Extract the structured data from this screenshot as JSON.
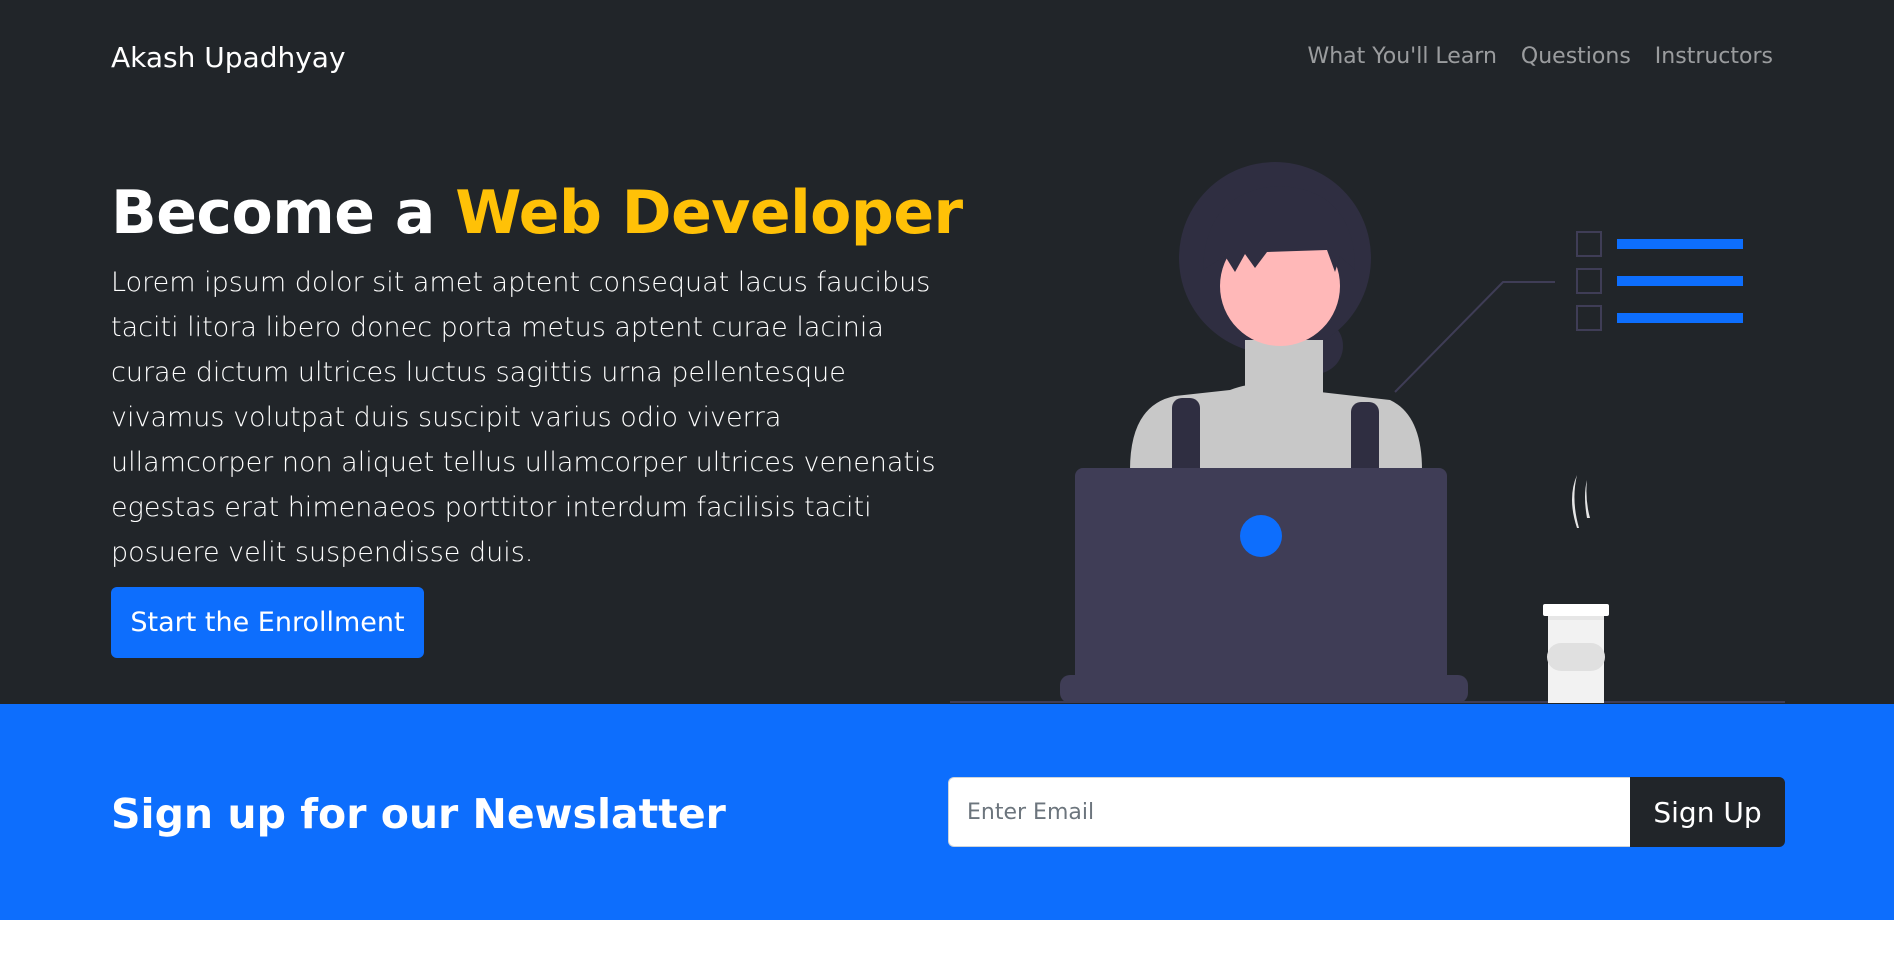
{
  "navbar": {
    "brand": "Akash Upadhyay",
    "links": [
      "What You'll Learn",
      "Questions",
      "Instructors"
    ]
  },
  "hero": {
    "title_prefix": "Become a ",
    "title_highlight": "Web Developer",
    "description": "Lorem ipsum dolor sit amet aptent consequat lacus faucibus taciti litora libero donec porta metus aptent curae lacinia curae dictum ultrices luctus sagittis urna pellentesque vivamus volutpat duis suscipit varius odio viverra ullamcorper non aliquet tellus ullamcorper ultrices venenatis egestas erat himenaeos porttitor interdum facilisis taciti posuere velit suspendisse duis.",
    "cta_label": "Start the Enrollment"
  },
  "newsletter": {
    "title": "Sign up for our Newslatter",
    "email_placeholder": "Enter Email",
    "email_value": "",
    "button_label": "Sign Up"
  },
  "colors": {
    "dark_bg": "#212529",
    "primary": "#0d6efd",
    "accent": "#ffc107"
  },
  "icons": {
    "illustration": "woman-at-laptop-illustration"
  }
}
